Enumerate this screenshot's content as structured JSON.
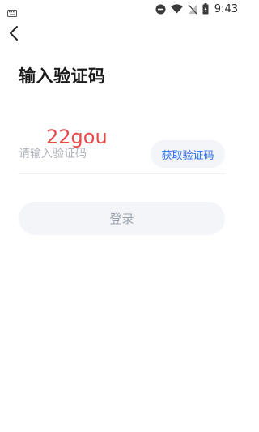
{
  "status_bar": {
    "time": "9:43",
    "icons": [
      "keyboard-icon",
      "do-not-disturb-icon",
      "wifi-icon",
      "no-sim-icon",
      "battery-icon"
    ]
  },
  "header": {
    "back_icon": "chevron-left-icon"
  },
  "page": {
    "title": "输入验证码"
  },
  "form": {
    "code_placeholder": "请输入验证码",
    "get_code_label": "获取验证码",
    "login_label": "登录"
  },
  "watermark": {
    "text": "22gou"
  },
  "colors": {
    "accent": "#2b6ff0",
    "button_bg": "#f3f5f9",
    "disabled_text": "#9aa0aa",
    "watermark": "#e84a4a"
  }
}
